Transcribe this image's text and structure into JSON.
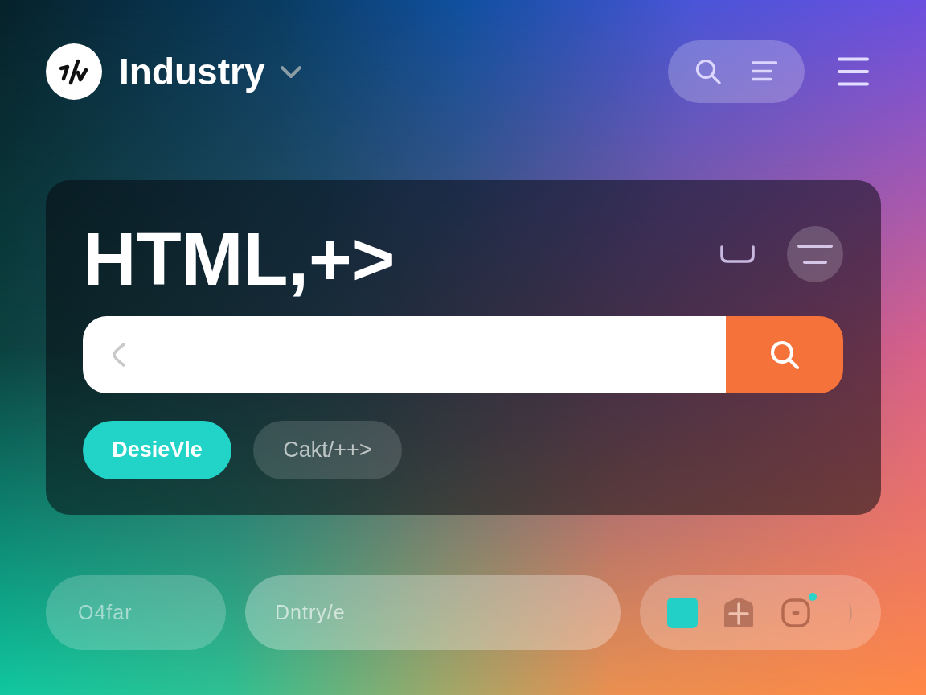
{
  "header": {
    "brand": "Industry"
  },
  "hero": {
    "title": "HTML,+>",
    "chips": [
      {
        "label": "DesieVle",
        "selected": true
      },
      {
        "label": "Cakt/++>",
        "selected": false
      }
    ]
  },
  "bottom_bar": {
    "chip": "O4far",
    "field": {
      "placeholder": "Dntry/e"
    },
    "tray": {
      "badge": true
    }
  }
}
